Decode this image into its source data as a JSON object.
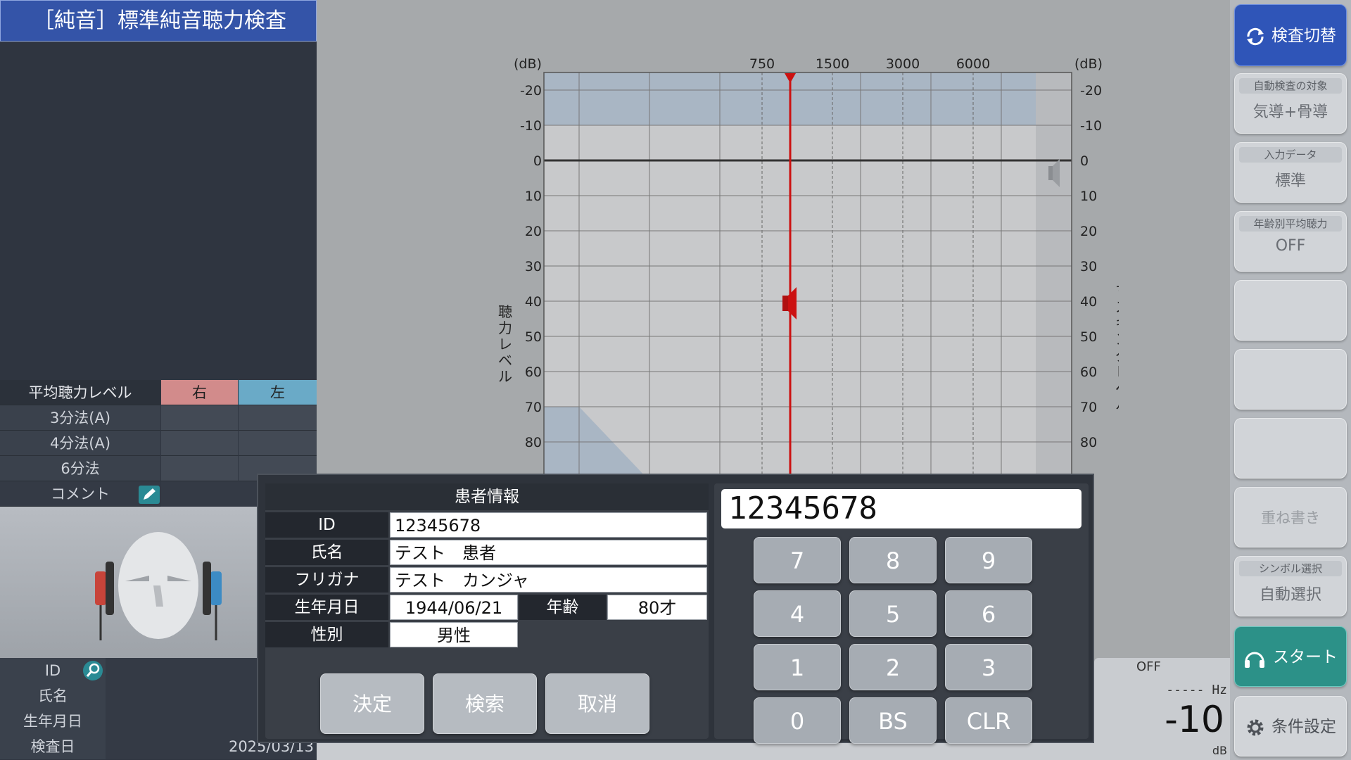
{
  "title": "［純音］標準純音聴力検査",
  "avg": {
    "header": {
      "label": "平均聴力レベル",
      "right": "右",
      "left": "左"
    },
    "rows": [
      {
        "label": "3分法(A)",
        "right": "",
        "left": ""
      },
      {
        "label": "4分法(A)",
        "right": "",
        "left": ""
      },
      {
        "label": "6分法",
        "right": "",
        "left": ""
      }
    ],
    "comment_label": "コメント"
  },
  "patient_panel": {
    "rows": [
      {
        "label": "ID",
        "value": ""
      },
      {
        "label": "氏名",
        "value": ""
      },
      {
        "label": "生年月日",
        "value": "----------"
      },
      {
        "label": "検査日",
        "value": "2025/03/13"
      }
    ]
  },
  "chart": {
    "db_unit": "(dB)",
    "freq_top": [
      "750",
      "1500",
      "3000",
      "6000"
    ],
    "db_ticks": [
      "-20",
      "-10",
      "0",
      "10",
      "20",
      "30",
      "40",
      "50",
      "60",
      "70",
      "80"
    ],
    "left_axis_label": "聴力レベル",
    "right_axis_label": "マスキングレベル"
  },
  "right_panel": {
    "switch": "検査切替",
    "auto_target": {
      "label": "自動検査の対象",
      "value": "気導+骨導"
    },
    "input_data": {
      "label": "入力データ",
      "value": "標準"
    },
    "age_avg": {
      "label": "年齢別平均聴力",
      "value": "OFF"
    },
    "overwrite": "重ね書き",
    "symbol": {
      "label": "シンボル選択",
      "value": "自動選択"
    },
    "start": "スタート",
    "settings": "条件設定"
  },
  "dialog": {
    "title": "患者情報",
    "fields": {
      "id": {
        "label": "ID",
        "value": "12345678"
      },
      "name": {
        "label": "氏名",
        "value": "テスト　患者"
      },
      "furigana": {
        "label": "フリガナ",
        "value": "テスト　カンジャ"
      },
      "dob": {
        "label": "生年月日",
        "value": "1944/06/21"
      },
      "age": {
        "label": "年齢",
        "value": "80才"
      },
      "sex": {
        "label": "性別",
        "value": "男性"
      }
    },
    "buttons": {
      "ok": "決定",
      "search": "検索",
      "cancel": "取消"
    },
    "display": "12345678",
    "keys": [
      "7",
      "8",
      "9",
      "4",
      "5",
      "6",
      "1",
      "2",
      "3",
      "0",
      "BS",
      "CLR"
    ]
  },
  "bottom": {
    "off": "OFF",
    "hz": "----- Hz",
    "value": "-10",
    "db": "dB"
  }
}
